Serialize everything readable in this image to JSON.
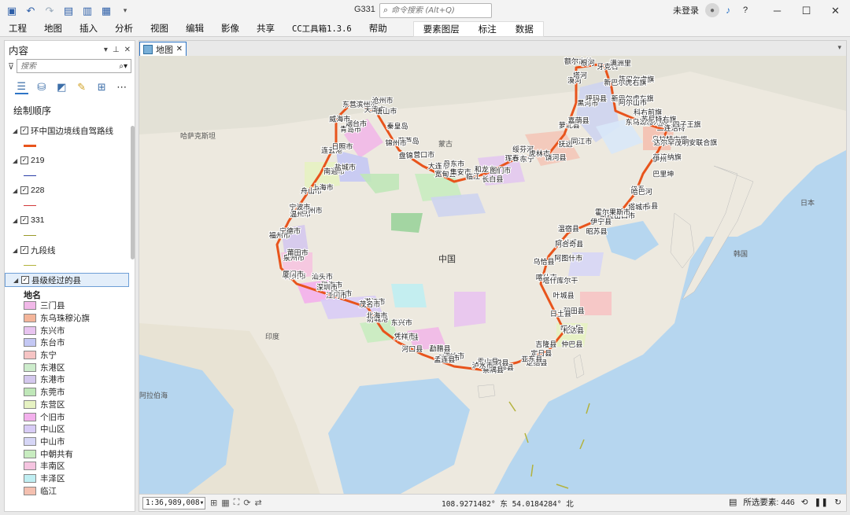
{
  "titlebar": {
    "app_title": "G331",
    "search_placeholder": "命令搜索 (Alt+Q)",
    "user": "未登录",
    "help_icon": "?"
  },
  "ribbon": {
    "tabs": [
      "工程",
      "地图",
      "插入",
      "分析",
      "视图",
      "编辑",
      "影像",
      "共享",
      "CC工具箱1.3.6",
      "帮助"
    ],
    "context_tabs": [
      "要素图层",
      "标注",
      "数据"
    ]
  },
  "contents": {
    "title": "内容",
    "search_placeholder": "搜索",
    "drawing_order": "绘制顺序",
    "layers": [
      {
        "name": "环中国边境线自驾路线",
        "checked": true,
        "color": "#e8541c",
        "width": 3
      },
      {
        "name": "219",
        "checked": true,
        "color": "#2a3fa8",
        "width": 1
      },
      {
        "name": "228",
        "checked": true,
        "color": "#d23a3a",
        "width": 1
      },
      {
        "name": "331",
        "checked": true,
        "color": "#9a9a2a",
        "width": 1
      },
      {
        "name": "九段线",
        "checked": true,
        "color": "#b3b23c",
        "width": 1
      },
      {
        "name": "县级经过的县",
        "checked": true,
        "selected": true
      }
    ],
    "legend_field": "地名",
    "legend_items": [
      {
        "label": "三门县",
        "color": "#f1b8e8"
      },
      {
        "label": "东乌珠穆沁旗",
        "color": "#f4b59a"
      },
      {
        "label": "东兴市",
        "color": "#e8c4f0"
      },
      {
        "label": "东台市",
        "color": "#c4c8f4"
      },
      {
        "label": "东宁",
        "color": "#f6c4c4"
      },
      {
        "label": "东港区",
        "color": "#cdeccc"
      },
      {
        "label": "东港市",
        "color": "#d4c8ee"
      },
      {
        "label": "东莞市",
        "color": "#bfe7b8"
      },
      {
        "label": "东营区",
        "color": "#e6f2c2"
      },
      {
        "label": "个旧市",
        "color": "#f3b0ec"
      },
      {
        "label": "中山区",
        "color": "#d8ccf6"
      },
      {
        "label": "中山市",
        "color": "#d6d6f6"
      },
      {
        "label": "中朝共有",
        "color": "#c8ecc0"
      },
      {
        "label": "丰南区",
        "color": "#f5c4e0"
      },
      {
        "label": "丰泽区",
        "color": "#bfeef2"
      },
      {
        "label": "临江",
        "color": "#f4c0b0"
      }
    ]
  },
  "map": {
    "tab_label": "地图",
    "country_labels": [
      {
        "text": "哈萨克斯坦"
      },
      {
        "text": "蒙古"
      },
      {
        "text": "中国"
      },
      {
        "text": "印度"
      },
      {
        "text": "韩国"
      },
      {
        "text": "日本"
      },
      {
        "text": "阿拉伯海"
      }
    ],
    "county_labels": [
      "额尔古纳",
      "根河",
      "牙克石",
      "满洲里",
      "陈巴尔虎旗",
      "新巴尔虎右旗",
      "新巴尔虎左旗",
      "阿尔山市",
      "科右前旗",
      "东乌珠穆沁旗",
      "苏尼特右旗",
      "二连浩特",
      "四子王旗",
      "乌拉特中旗",
      "达尔罕茂明安联合旗",
      "额济纳旗",
      "伊州",
      "巴里坤",
      "伊吾",
      "哈巴河",
      "吉木乃县",
      "塔城市",
      "阿拉山口市",
      "霍尔果斯市",
      "伊宁县",
      "昭苏县",
      "温宿县",
      "乌什县",
      "阿合奇县",
      "阿图什市",
      "乌恰县",
      "喀什市",
      "塔什库尔干",
      "叶城县",
      "和田县",
      "日土县",
      "噶尔县",
      "札达县",
      "仲巴县",
      "吉隆县",
      "定日县",
      "定结县",
      "亚东县",
      "错那县",
      "墨脱县",
      "察隅县",
      "贡山县",
      "泸水市",
      "腾冲市",
      "瑞丽市",
      "孟连县",
      "勐腊县",
      "河口县",
      "那坡县",
      "凭祥市",
      "东兴市",
      "防城港",
      "北海市",
      "湛江市",
      "茂名市",
      "阳江市",
      "江门市",
      "珠海市",
      "深圳市",
      "汕头市",
      "漳州市",
      "厦门市",
      "泉州市",
      "莆田市",
      "福州市",
      "宁德市",
      "温州市",
      "台州市",
      "宁波市",
      "舟山市",
      "上海市",
      "南通市",
      "盐城市",
      "连云港",
      "日照市",
      "青岛市",
      "烟台市",
      "威海市",
      "东营区",
      "滨州市",
      "沧州市",
      "天津市",
      "唐山市",
      "秦皇岛",
      "葫芦岛",
      "锦州市",
      "盘锦市",
      "营口市",
      "大连市",
      "丹东市",
      "宽甸县",
      "集安市",
      "临江",
      "长白县",
      "和龙市",
      "图们市",
      "珲春市",
      "东宁",
      "绥芬河",
      "虎林市",
      "饶河县",
      "抚远",
      "同江市",
      "萝北县",
      "嘉荫县",
      "黑河市",
      "呼玛县",
      "漠河",
      "塔河"
    ]
  },
  "statusbar": {
    "scale": "1:36,989,008",
    "coords": "108.9271482° 东  54.0184284° 北",
    "selected_features": "所选要素: 446"
  }
}
